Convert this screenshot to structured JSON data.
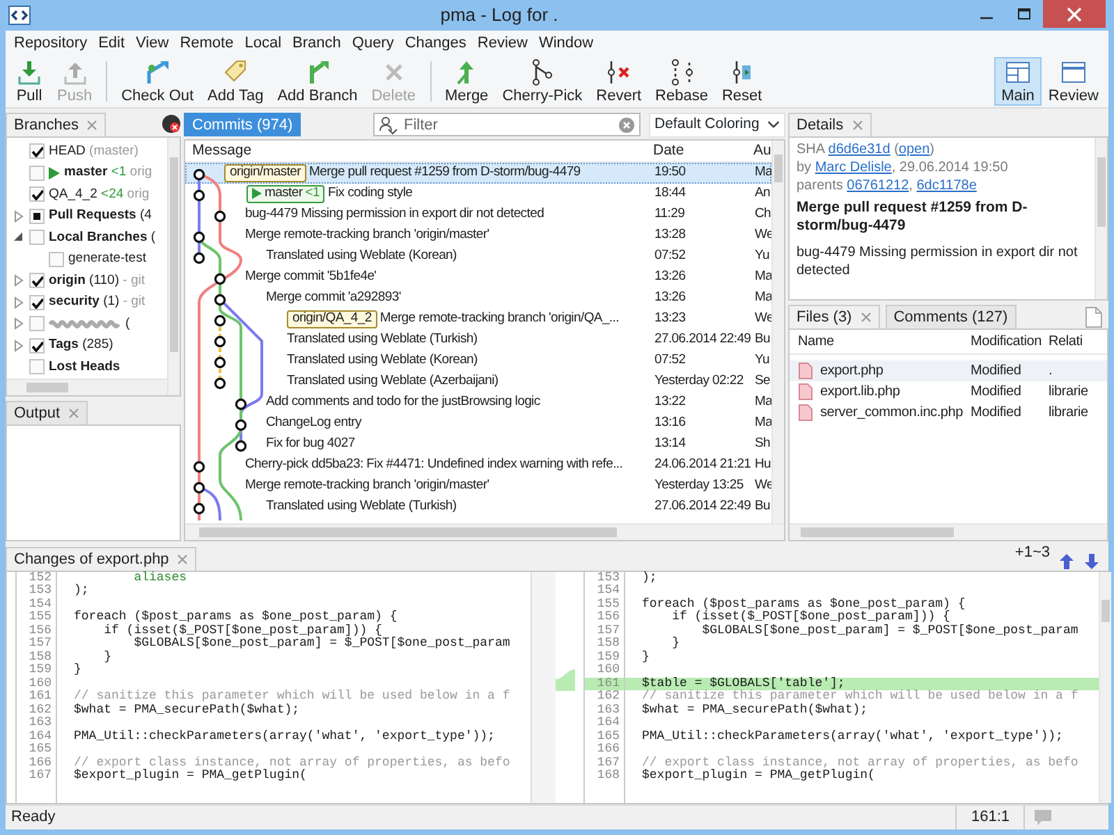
{
  "window": {
    "title": "pma - Log for ."
  },
  "menu": [
    "Repository",
    "Edit",
    "View",
    "Remote",
    "Local",
    "Branch",
    "Query",
    "Changes",
    "Review",
    "Window"
  ],
  "toolbar": {
    "groups": [
      [
        {
          "label": "Pull",
          "disabled": false
        },
        {
          "label": "Push",
          "disabled": true
        }
      ],
      [
        {
          "label": "Check Out",
          "disabled": false
        },
        {
          "label": "Add Tag",
          "disabled": false
        },
        {
          "label": "Add Branch",
          "disabled": false
        },
        {
          "label": "Delete",
          "disabled": true
        }
      ],
      [
        {
          "label": "Merge",
          "disabled": false
        },
        {
          "label": "Cherry-Pick",
          "disabled": false
        },
        {
          "label": "Revert",
          "disabled": false
        },
        {
          "label": "Rebase",
          "disabled": false
        },
        {
          "label": "Reset",
          "disabled": false
        }
      ]
    ],
    "views": [
      {
        "label": "Main",
        "selected": true
      },
      {
        "label": "Review",
        "selected": false
      }
    ]
  },
  "branches": {
    "tab": {
      "label": "Branches",
      "active": false
    },
    "items": [
      {
        "name": "HEAD",
        "bold": false,
        "current": false,
        "checked": true,
        "note": "(master)"
      },
      {
        "name": "master",
        "bold": true,
        "current": true,
        "checked": false,
        "ahead": "<1",
        "note": "orig"
      },
      {
        "name": "QA_4_2",
        "bold": false,
        "current": false,
        "checked": true,
        "ahead": "<24",
        "note": "orig"
      },
      {
        "name": "Pull Requests",
        "bold": true,
        "current": false,
        "indeterminate": true,
        "expanded": false,
        "count": "(4"
      },
      {
        "name": "Local Branches",
        "bold": true,
        "current": false,
        "checked": false,
        "expanded": true,
        "count": "(",
        "children": [
          {
            "name": "generate-test",
            "bold": false,
            "current": false,
            "checked": false
          }
        ]
      },
      {
        "name": "origin",
        "bold": true,
        "current": false,
        "checked": true,
        "expanded": false,
        "count": "(110)",
        "note": "- git"
      },
      {
        "name": "security",
        "bold": true,
        "current": false,
        "checked": true,
        "expanded": false,
        "count": "(1)",
        "note": "- git"
      },
      {
        "kind": "redacted",
        "current": false,
        "checked": false,
        "expanded": false,
        "count": "("
      },
      {
        "name": "Tags",
        "bold": true,
        "current": false,
        "checked": true,
        "expanded": false,
        "count": "(285)"
      },
      {
        "name": "Lost Heads",
        "bold": true,
        "current": false,
        "checked": false
      }
    ]
  },
  "output": {
    "tab": {
      "label": "Output",
      "active": false
    }
  },
  "commits": {
    "tab": {
      "label": "Commits (974)",
      "active": true
    },
    "filter": {
      "placeholder": "Filter"
    },
    "coloring": "Default Coloring",
    "columns": [
      "Message",
      "Date",
      "Au"
    ],
    "rows": [
      {
        "refs": [
          {
            "kind": "remote",
            "label": "origin/master"
          }
        ],
        "message": "Merge pull request #1259 from D-storm/bug-4479",
        "date": "19:50",
        "author": "Ma",
        "selected": true
      },
      {
        "refs": [
          {
            "kind": "head",
            "label": "master",
            "ahead": "<1"
          }
        ],
        "message": "Fix coding style",
        "date": "18:44",
        "author": "An",
        "selected": false
      },
      {
        "message": "bug-4479 Missing permission in export dir not detected",
        "date": "11:29",
        "author": "Ch",
        "selected": false
      },
      {
        "message": "Merge remote-tracking branch 'origin/master'",
        "date": "13:28",
        "author": "We",
        "selected": false
      },
      {
        "message": "Translated using Weblate (Korean)",
        "date": "07:52",
        "author": "Yu",
        "selected": false
      },
      {
        "message": "Merge commit '5b1fe4e'",
        "date": "13:26",
        "author": "Ma",
        "selected": false
      },
      {
        "message": "Merge commit 'a292893'",
        "date": "13:26",
        "author": "Ma",
        "selected": false
      },
      {
        "refs": [
          {
            "kind": "remote",
            "label": "origin/QA_4_2"
          }
        ],
        "message": "Merge remote-tracking branch 'origin/QA_...",
        "date": "13:23",
        "author": "We",
        "selected": false
      },
      {
        "message": "Translated using Weblate (Turkish)",
        "date": "27.06.2014 22:49",
        "author": "Bu",
        "selected": false
      },
      {
        "message": "Translated using Weblate (Korean)",
        "date": "07:52",
        "author": "Yu",
        "selected": false
      },
      {
        "message": "Translated using Weblate (Azerbaijani)",
        "date": "Yesterday 02:22",
        "author": "Se",
        "selected": false
      },
      {
        "message": "Add comments and todo for the justBrowsing logic",
        "date": "13:22",
        "author": "Ma",
        "selected": false
      },
      {
        "message": "ChangeLog entry",
        "date": "13:16",
        "author": "Ma",
        "selected": false
      },
      {
        "message": "Fix for bug 4027",
        "date": "13:14",
        "author": "Sh",
        "selected": false
      },
      {
        "message": "Cherry-pick dd5ba23: Fix #4471: Undefined index warning with refe...",
        "date": "24.06.2014 21:21",
        "author": "Hu",
        "selected": false
      },
      {
        "message": "Merge remote-tracking branch 'origin/master'",
        "date": "Yesterday 13:25",
        "author": "We",
        "selected": false
      },
      {
        "message": "Translated using Weblate (Turkish)",
        "date": "27.06.2014 22:49",
        "author": "Bu",
        "selected": false
      }
    ]
  },
  "details": {
    "tab": {
      "label": "Details",
      "active": false
    },
    "sha_line": [
      {
        "text": "SHA "
      },
      {
        "link": "d6d6e31d"
      },
      {
        "text": " ("
      },
      {
        "link": "open"
      },
      {
        "text": ")"
      }
    ],
    "author_line": [
      {
        "text": "by "
      },
      {
        "link": "Marc Delisle"
      },
      {
        "text": ", 29.06.2014 19:50"
      }
    ],
    "parents_line": [
      {
        "text": "parents "
      },
      {
        "link": "06761212"
      },
      {
        "text": ", "
      },
      {
        "link": "6dc1178e"
      }
    ],
    "title": "Merge pull request #1259 from D-storm/bug-4479",
    "body": "bug-4479 Missing permission in export dir not detected"
  },
  "files": {
    "tabs": [
      {
        "label": "Files (3)",
        "selected": true
      },
      {
        "label": "Comments (127)",
        "selected": false
      }
    ],
    "columns": [
      "Name",
      "Modification",
      "Relati"
    ],
    "rows": [
      {
        "name": "export.php",
        "modification": "Modified",
        "path": ".",
        "selected": true
      },
      {
        "name": "export.lib.php",
        "modification": "Modified",
        "path": "librarie",
        "selected": false
      },
      {
        "name": "server_common.inc.php",
        "modification": "Modified",
        "path": "librarie",
        "selected": false
      }
    ]
  },
  "diff": {
    "tab": {
      "label": "Changes of export.php",
      "active": false
    },
    "summary": "+1~3",
    "left": [
      {
        "num": "152",
        "text": "        aliases",
        "kind": "string"
      },
      {
        "num": "153",
        "text": ");",
        "kind": "code"
      },
      {
        "num": "154"
      },
      {
        "num": "155",
        "text": "foreach ($post_params as $one_post_param) {",
        "kind": "code"
      },
      {
        "num": "156",
        "text": "    if (isset($_POST[$one_post_param])) {",
        "kind": "code"
      },
      {
        "num": "157",
        "text": "        $GLOBALS[$one_post_param] = $_POST[$one_post_param",
        "kind": "code"
      },
      {
        "num": "158",
        "text": "    }",
        "kind": "code"
      },
      {
        "num": "159",
        "text": "}",
        "kind": "code"
      },
      {
        "num": "160"
      },
      {
        "num": "161",
        "text": "// sanitize this parameter which will be used below in a f",
        "kind": "comment"
      },
      {
        "num": "162",
        "text": "$what = PMA_securePath($what);",
        "kind": "code"
      },
      {
        "num": "163"
      },
      {
        "num": "164",
        "text": "PMA_Util::checkParameters(array('what', 'export_type'));",
        "kind": "code"
      },
      {
        "num": "165"
      },
      {
        "num": "166",
        "text": "// export class instance, not array of properties, as befo",
        "kind": "comment"
      },
      {
        "num": "167",
        "text": "$export_plugin = PMA_getPlugin(",
        "kind": "code"
      }
    ],
    "right": [
      {
        "num": "153",
        "text": ");",
        "kind": "code"
      },
      {
        "num": "154"
      },
      {
        "num": "155",
        "text": "foreach ($post_params as $one_post_param) {",
        "kind": "code"
      },
      {
        "num": "156",
        "text": "    if (isset($_POST[$one_post_param])) {",
        "kind": "code"
      },
      {
        "num": "157",
        "text": "        $GLOBALS[$one_post_param] = $_POST[$one_post_param",
        "kind": "code"
      },
      {
        "num": "158",
        "text": "    }",
        "kind": "code"
      },
      {
        "num": "159",
        "text": "}",
        "kind": "code"
      },
      {
        "num": "160"
      },
      {
        "num": "161",
        "text": "$table = $GLOBALS['table'];",
        "kind": "added"
      },
      {
        "num": "162",
        "text": "// sanitize this parameter which will be used below in a f",
        "kind": "comment"
      },
      {
        "num": "163",
        "text": "$what = PMA_securePath($what);",
        "kind": "code"
      },
      {
        "num": "164"
      },
      {
        "num": "165",
        "text": "PMA_Util::checkParameters(array('what', 'export_type'));",
        "kind": "code"
      },
      {
        "num": "166"
      },
      {
        "num": "167",
        "text": "// export class instance, not array of properties, as befo",
        "kind": "comment"
      },
      {
        "num": "168",
        "text": "$export_plugin = PMA_getPlugin(",
        "kind": "code"
      }
    ]
  },
  "status_bar": {
    "message": "Ready",
    "position": "161:1"
  }
}
